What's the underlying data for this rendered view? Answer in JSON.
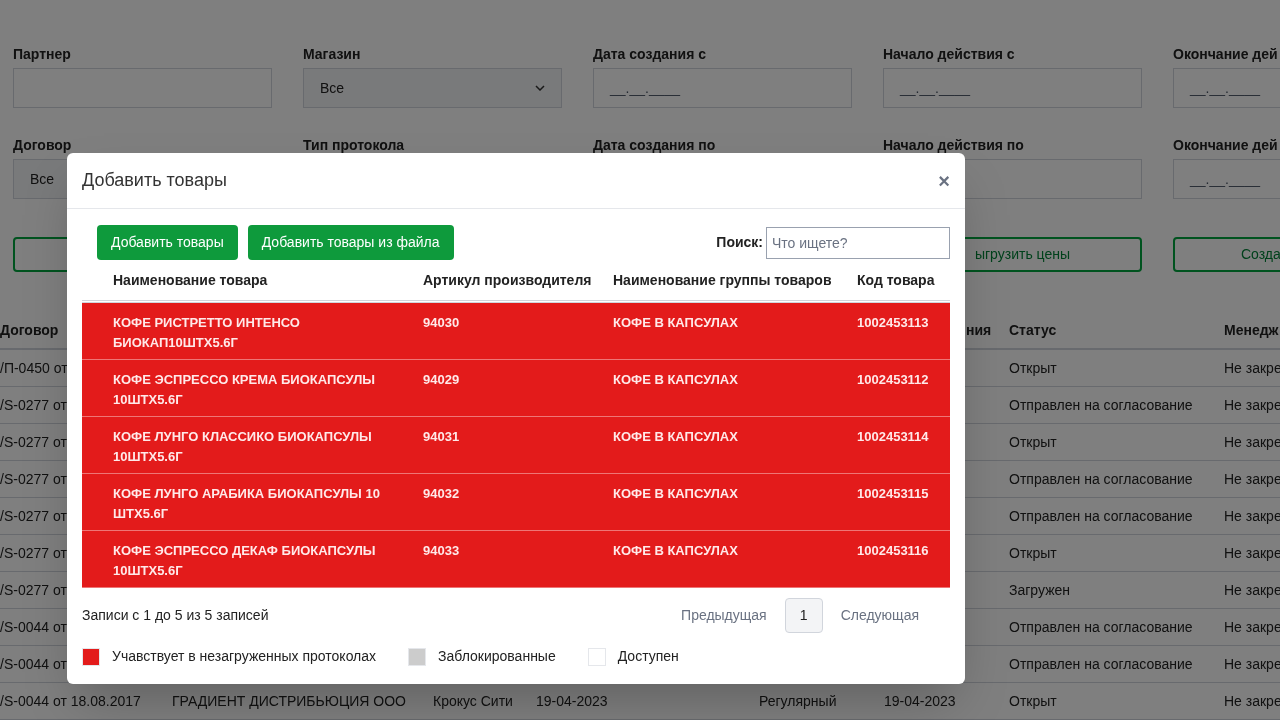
{
  "background": {
    "filters": [
      {
        "label": "Партнер",
        "kind": "text"
      },
      {
        "label": "Магазин",
        "kind": "select",
        "value": "Все"
      },
      {
        "label": "Дата создания с",
        "kind": "text",
        "value": "__.__.____"
      },
      {
        "label": "Начало действия с",
        "kind": "text",
        "value": "__.__.____"
      },
      {
        "label": "Окончание дей",
        "kind": "text",
        "value": "__.__.____"
      },
      {
        "label": "Договор",
        "kind": "covered-select",
        "value": "Все"
      },
      {
        "label": "Тип протокола",
        "kind": "hidden"
      },
      {
        "label": "Дата создания по",
        "kind": "hidden"
      },
      {
        "label": "Начало действия по",
        "kind": "text"
      },
      {
        "label": "Окончание дей",
        "kind": "text",
        "value": "__.__.____"
      }
    ],
    "actions": [
      {
        "kind": "empty"
      },
      {
        "kind": "hidden"
      },
      {
        "kind": "hidden"
      },
      {
        "kind": "button",
        "label": "ыгрузить цены"
      },
      {
        "kind": "button",
        "label": "Созда"
      }
    ],
    "table": {
      "columns": [
        {
          "header": "Договор"
        },
        {},
        {},
        {},
        {},
        {
          "header": "ния"
        },
        {
          "header": "Статус"
        },
        {
          "header": "Менедж"
        }
      ],
      "rows": [
        {
          "cells": [
            "/П-0450 от",
            null,
            null,
            null,
            null,
            null,
            "Открыт",
            "Не закре"
          ]
        },
        {
          "cells": [
            "/S-0277 от",
            null,
            null,
            null,
            null,
            null,
            "Отправлен на согласование",
            "Не закре"
          ]
        },
        {
          "cells": [
            "/S-0277 от",
            null,
            null,
            null,
            null,
            null,
            "Открыт",
            "Не закре"
          ]
        },
        {
          "cells": [
            "/S-0277 от",
            null,
            null,
            null,
            null,
            null,
            "Отправлен на согласование",
            "Не закре"
          ]
        },
        {
          "cells": [
            "/S-0277 от",
            null,
            null,
            null,
            null,
            null,
            "Отправлен на согласование",
            "Не закре"
          ]
        },
        {
          "cells": [
            "/S-0277 от",
            null,
            null,
            null,
            null,
            null,
            "Открыт",
            "Не закре"
          ]
        },
        {
          "cells": [
            "/S-0277 от",
            null,
            null,
            null,
            null,
            null,
            "Загружен",
            "Не закре"
          ]
        },
        {
          "cells": [
            "/S-0044 от",
            null,
            null,
            null,
            null,
            null,
            "Отправлен на согласование",
            "Не закре"
          ]
        },
        {
          "cells": [
            "/S-0044 от",
            null,
            null,
            null,
            null,
            null,
            "Отправлен на согласование",
            "Не закре"
          ]
        },
        {
          "cells": [
            "/S-0044 от 18.08.2017",
            "ГРАДИЕНТ ДИСТРИБЬЮЦИЯ ООО",
            "Крокус Сити",
            "19-04-2023",
            "Регулярный",
            "19-04-2023",
            "Открыт",
            "Не закре"
          ]
        }
      ]
    }
  },
  "modal": {
    "title": "Добавить товары",
    "close": "×",
    "buttons": [
      "Добавить товары",
      "Добавить товары из файла"
    ],
    "search": {
      "label": "Поиск:",
      "placeholder": "Что ищете?"
    },
    "table": {
      "columns": [
        "Наименование товара",
        "Артикул производителя",
        "Наименование группы товаров",
        "Код товара"
      ],
      "rows": [
        {
          "color": "#e31b1b",
          "cells": [
            "КОФЕ РИСТРЕТТО ИНТЕНСО БИОКАП10ШТХ5.6Г",
            "94030",
            "КОФЕ В КАПСУЛАХ",
            "1002453113"
          ]
        },
        {
          "color": "#e31b1b",
          "cells": [
            "КОФЕ ЭСПРЕССО КРЕМА БИОКАПСУЛЫ 10ШТХ5.6Г",
            "94029",
            "КОФЕ В КАПСУЛАХ",
            "1002453112"
          ]
        },
        {
          "color": "#e31b1b",
          "cells": [
            "КОФЕ ЛУНГО КЛАССИКО БИОКАПСУЛЫ 10ШТХ5.6Г",
            "94031",
            "КОФЕ В КАПСУЛАХ",
            "1002453114"
          ]
        },
        {
          "color": "#e31b1b",
          "cells": [
            "КОФЕ ЛУНГО АРАБИКА БИОКАПСУЛЫ 10 ШТХ5.6Г",
            "94032",
            "КОФЕ В КАПСУЛАХ",
            "1002453115"
          ]
        },
        {
          "color": "#e31b1b",
          "cells": [
            "КОФЕ ЭСПРЕССО ДЕКАФ БИОКАПСУЛЫ 10ШТХ5.6Г",
            "94033",
            "КОФЕ В КАПСУЛАХ",
            "1002453116"
          ]
        }
      ]
    },
    "info": "Записи с 1 до 5 из 5 записей",
    "pagination": {
      "previous": "Предыдущая",
      "pages": [
        {
          "label": "1",
          "selected": true
        }
      ],
      "next": "Следующая"
    },
    "legend": [
      {
        "color": "#e31b1b",
        "label": "Учавствует в незагруженных протоколах"
      },
      {
        "color": "#cccccc",
        "label": "Заблокированные"
      },
      {
        "color": "#ffffff",
        "label": "Доступен"
      }
    ]
  }
}
